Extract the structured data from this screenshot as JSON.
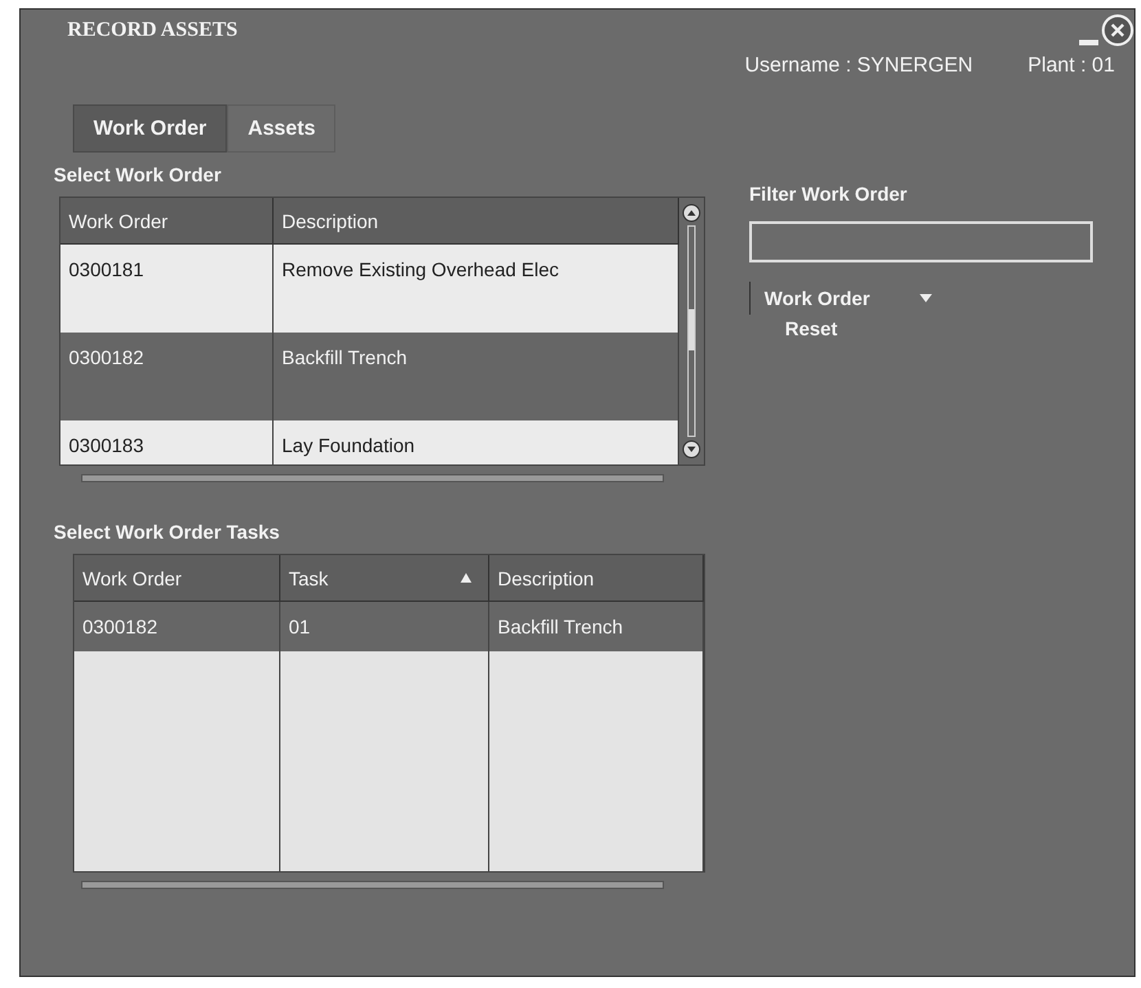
{
  "window": {
    "title": "RECORD ASSETS"
  },
  "user_info": {
    "username": "Username : SYNERGEN",
    "plant": "Plant : 01"
  },
  "tabs": [
    {
      "label": "Work Order",
      "selected": true
    },
    {
      "label": "Assets",
      "selected": false
    }
  ],
  "work_orders": {
    "title": "Select Work Order",
    "columns": [
      {
        "label": "Work Order"
      },
      {
        "label": "Description"
      }
    ],
    "rows": [
      {
        "cells": [
          "0300181",
          "Remove Existing Overhead Elec"
        ],
        "selected": false
      },
      {
        "cells": [
          "0300182",
          "Backfill Trench"
        ],
        "selected": true
      },
      {
        "cells": [
          "0300183",
          "Lay Foundation"
        ],
        "selected": false
      }
    ]
  },
  "tasks": {
    "title": "Select Work Order Tasks",
    "columns": [
      {
        "label": "Work Order",
        "sorted": false
      },
      {
        "label": "Task",
        "sorted": true
      },
      {
        "label": "Description",
        "sorted": false
      }
    ],
    "rows": [
      {
        "cells": [
          "0300182",
          "01",
          "Backfill Trench"
        ],
        "selected": true
      }
    ]
  },
  "filter": {
    "title": "Filter Work Order",
    "dropdown": "Work Order",
    "reset": "Reset"
  }
}
